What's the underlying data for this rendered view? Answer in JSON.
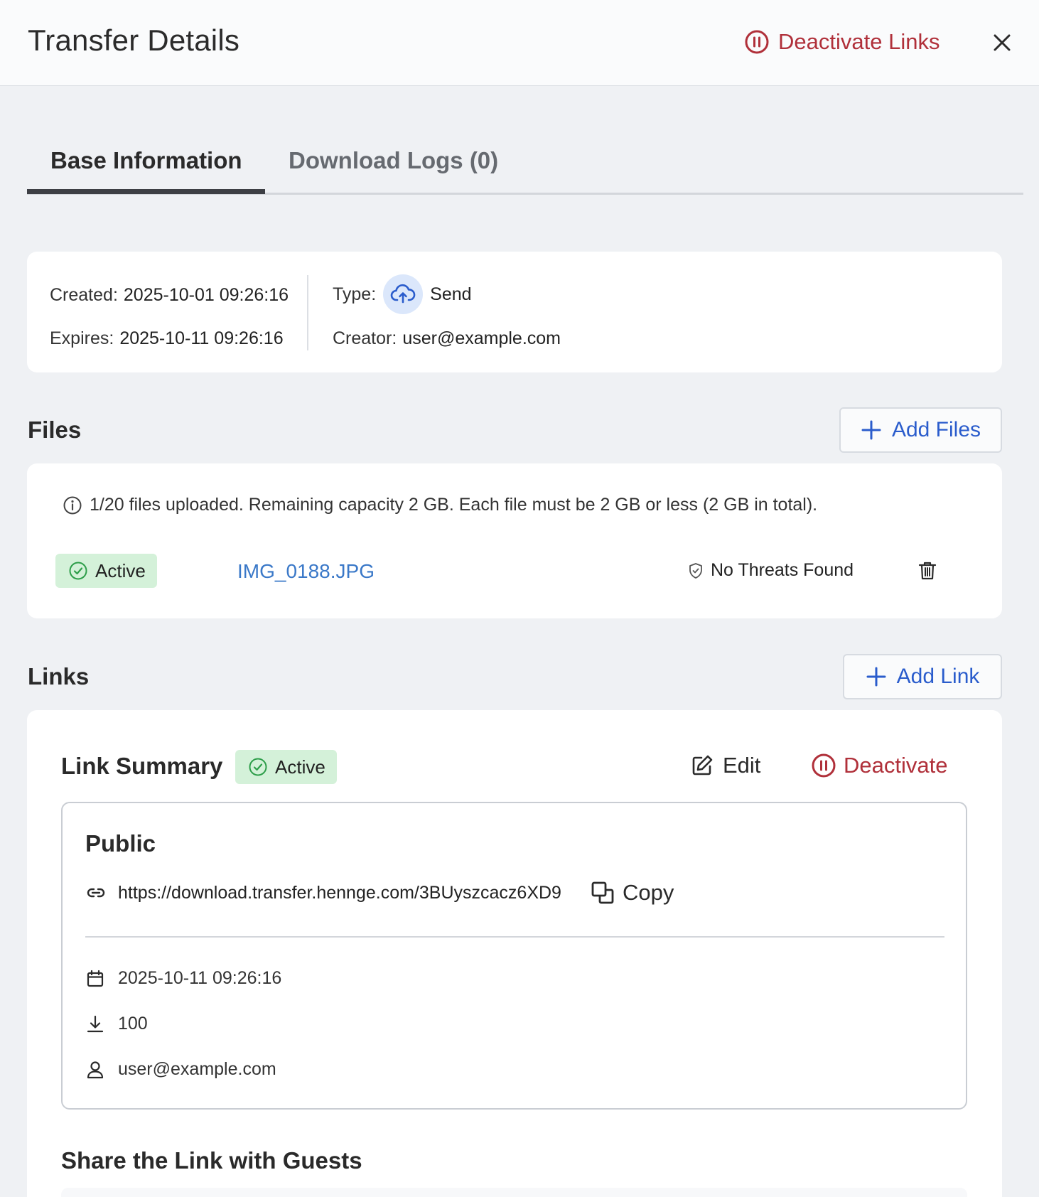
{
  "header": {
    "title": "Transfer Details",
    "deactivate_links_label": "Deactivate Links"
  },
  "tabs": [
    {
      "label": "Base Information",
      "active": true
    },
    {
      "label": "Download Logs (0)",
      "active": false
    }
  ],
  "base_info": {
    "created_label": "Created:",
    "created_value": "2025-10-01 09:26:16",
    "expires_label": "Expires:",
    "expires_value": "2025-10-11 09:26:16",
    "type_label": "Type:",
    "type_value": "Send",
    "creator_label": "Creator:",
    "creator_value": "user@example.com"
  },
  "files": {
    "section_title": "Files",
    "add_button_label": "Add Files",
    "info_text": "1/20 files uploaded. Remaining capacity 2 GB. Each file must be 2 GB or less (2 GB in total).",
    "items": [
      {
        "status": "Active",
        "name": "IMG_0188.JPG",
        "scan_result": "No Threats Found"
      }
    ]
  },
  "links": {
    "section_title": "Links",
    "add_button_label": "Add Link",
    "summary_title": "Link Summary",
    "summary_status": "Active",
    "edit_label": "Edit",
    "deactivate_label": "Deactivate",
    "public": {
      "title": "Public",
      "url": "https://download.transfer.hennge.com/3BUyszcacz6XD9",
      "copy_label": "Copy",
      "expiry": "2025-10-11 09:26:16",
      "download_limit": "100",
      "owner": "user@example.com"
    },
    "share_title": "Share the Link with Guests"
  },
  "colors": {
    "accent_blue": "#2a5ccc",
    "danger_red": "#b0303a",
    "active_green_bg": "#d4f1d9",
    "link_blue": "#3a78c8"
  }
}
